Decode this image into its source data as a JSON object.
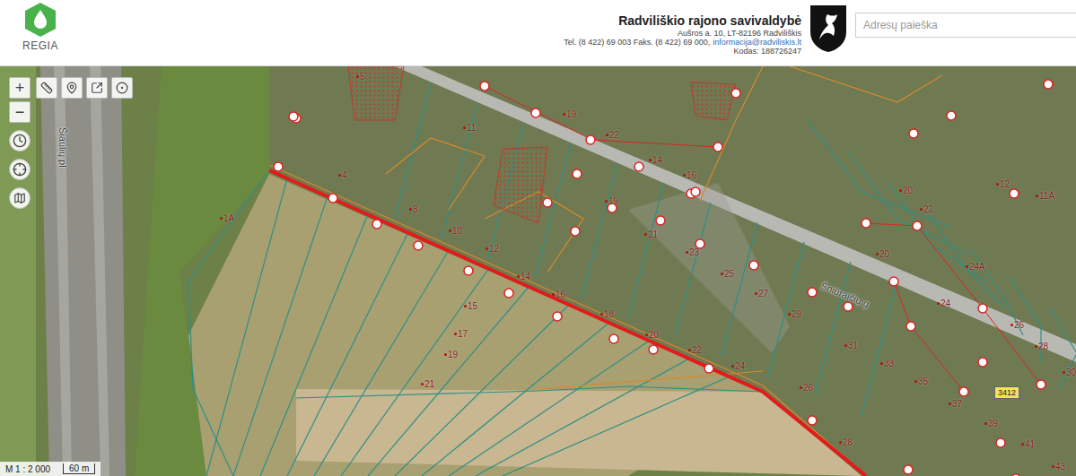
{
  "logo": {
    "text": "REGIA"
  },
  "header": {
    "title": "Radviliškio rajono savivaldybė",
    "address": "Aušros a. 10, LT-82196 Radviliškis",
    "phone": "Tel. (8 422) 69 003 Faks. (8 422) 69 000,",
    "email": "informacija@radviliskis.lt",
    "code": "Kodas: 188726247"
  },
  "search": {
    "placeholder": "Adresų paieška"
  },
  "zoom": [
    {
      "label": "+"
    },
    {
      "label": "−"
    }
  ],
  "map": {
    "streets": [
      {
        "label": "Šiaulių pl"
      },
      {
        "label": "Šniūraičių g"
      }
    ],
    "road_badge": "3412",
    "parcels": [
      {
        "label": "5"
      },
      {
        "label": "11"
      },
      {
        "label": "19"
      },
      {
        "label": "22"
      },
      {
        "label": "14"
      },
      {
        "label": "16"
      },
      {
        "label": "4"
      },
      {
        "label": "8"
      },
      {
        "label": "10"
      },
      {
        "label": "12"
      },
      {
        "label": "14"
      },
      {
        "label": "16"
      },
      {
        "label": "18"
      },
      {
        "label": "20"
      },
      {
        "label": "22"
      },
      {
        "label": "24"
      },
      {
        "label": "26"
      },
      {
        "label": "28"
      },
      {
        "label": "15"
      },
      {
        "label": "17"
      },
      {
        "label": "19"
      },
      {
        "label": "21"
      },
      {
        "label": "1A"
      },
      {
        "label": "19"
      },
      {
        "label": "21"
      },
      {
        "label": "23"
      },
      {
        "label": "25"
      },
      {
        "label": "27"
      },
      {
        "label": "29"
      },
      {
        "label": "12"
      },
      {
        "label": "11A"
      },
      {
        "label": "20"
      },
      {
        "label": "22"
      },
      {
        "label": "20"
      },
      {
        "label": "24A"
      },
      {
        "label": "24"
      },
      {
        "label": "26"
      },
      {
        "label": "28"
      },
      {
        "label": "30"
      },
      {
        "label": "31"
      },
      {
        "label": "33"
      },
      {
        "label": "35"
      },
      {
        "label": "37"
      },
      {
        "label": "39"
      },
      {
        "label": "41"
      },
      {
        "label": "43"
      }
    ]
  },
  "scale": {
    "ratio": "M 1 : 2 000",
    "distance": "60 m"
  }
}
